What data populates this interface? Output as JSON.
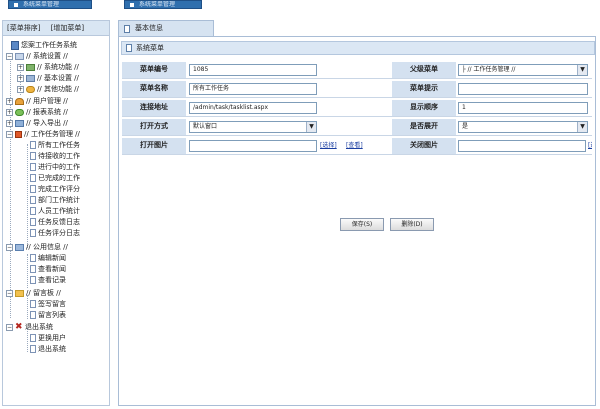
{
  "top_tabs": [
    "系统菜单管理",
    "系统菜单管理"
  ],
  "sidebar": {
    "header": [
      "[菜单排序]",
      "[增加菜单]"
    ],
    "tree": [
      {
        "label": "您案工作任务系统",
        "level": 0,
        "kind": "root"
      },
      {
        "label": "// 系统设置 //",
        "level": 0,
        "kind": "group"
      },
      {
        "label": "// 系统功能 //",
        "level": 1,
        "kind": "group"
      },
      {
        "label": "// 基本设置 //",
        "level": 1,
        "kind": "group"
      },
      {
        "label": "// 其他功能 //",
        "level": 1,
        "kind": "group"
      },
      {
        "label": "// 用户管理 //",
        "level": 0,
        "kind": "group"
      },
      {
        "label": "// 报表系统 //",
        "level": 0,
        "kind": "group"
      },
      {
        "label": "// 导入导出 //",
        "level": 0,
        "kind": "group"
      },
      {
        "label": "// 工作任务管理 //",
        "level": 0,
        "kind": "group-open"
      },
      {
        "label": "所有工作任务",
        "level": 1,
        "kind": "doc"
      },
      {
        "label": "待接收的工作",
        "level": 1,
        "kind": "doc"
      },
      {
        "label": "进行中的工作",
        "level": 1,
        "kind": "doc"
      },
      {
        "label": "已完成的工作",
        "level": 1,
        "kind": "doc"
      },
      {
        "label": "完成工作评分",
        "level": 1,
        "kind": "doc"
      },
      {
        "label": "部门工作统计",
        "level": 1,
        "kind": "doc"
      },
      {
        "label": "人员工作统计",
        "level": 1,
        "kind": "doc"
      },
      {
        "label": "任务反馈日志",
        "level": 1,
        "kind": "doc"
      },
      {
        "label": "任务评分日志",
        "level": 1,
        "kind": "doc"
      },
      {
        "label": "// 公用信息 //",
        "level": 0,
        "kind": "group-open"
      },
      {
        "label": "编辑新闻",
        "level": 1,
        "kind": "doc"
      },
      {
        "label": "查看新闻",
        "level": 1,
        "kind": "doc"
      },
      {
        "label": "查看记录",
        "level": 1,
        "kind": "doc"
      },
      {
        "label": "// 留言板 //",
        "level": 0,
        "kind": "group-open"
      },
      {
        "label": "签写留言",
        "level": 1,
        "kind": "doc"
      },
      {
        "label": "留言列表",
        "level": 1,
        "kind": "doc"
      },
      {
        "label": "退出系统",
        "level": 0,
        "kind": "group-open"
      },
      {
        "label": "更换用户",
        "level": 1,
        "kind": "doc"
      },
      {
        "label": "退出系统",
        "level": 1,
        "kind": "doc"
      }
    ]
  },
  "main": {
    "tab_label": "基本信息",
    "title": "系统菜单",
    "fields": {
      "menu_id_label": "菜单编号",
      "menu_id_value": "1085",
      "parent_label": "父级菜单",
      "parent_value": "├ // 工作任务管理 //",
      "menu_name_label": "菜单名称",
      "menu_name_value": "所有工作任务",
      "tip_label": "菜单提示",
      "tip_value": "",
      "url_label": "连接地址",
      "url_value": "/admin/task/tasklist.aspx",
      "order_label": "显示顺序",
      "order_value": "1",
      "open_label": "打开方式",
      "open_value": "默认窗口",
      "expand_label": "是否展开",
      "expand_value": "是",
      "open_img_label": "打开图片",
      "open_img_value": "",
      "close_img_label": "关闭图片",
      "close_img_value": "",
      "select_link": "[选择]",
      "view_link": "[查看]",
      "close_select_link": "[选"
    },
    "save_button": "保存(S)",
    "delete_button": "删除(D)"
  }
}
